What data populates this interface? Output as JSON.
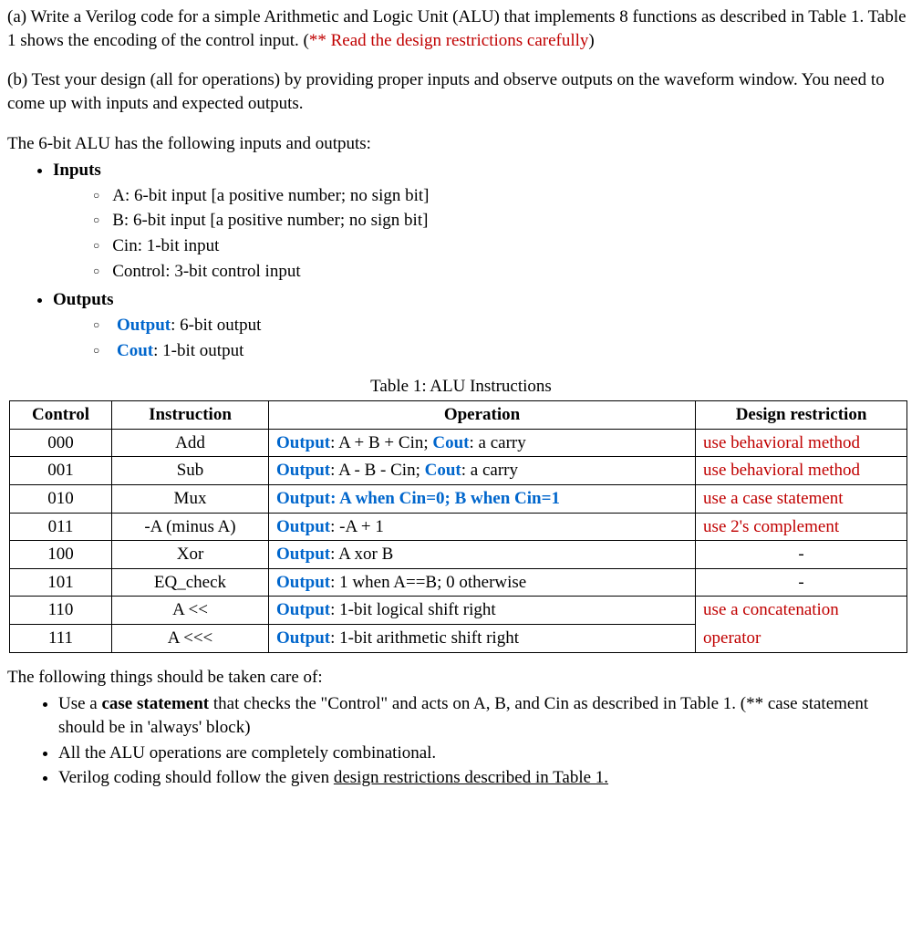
{
  "partA": {
    "prefix": "(a) Write a Verilog code for a simple Arithmetic and Logic Unit (ALU) that implements 8 functions as described in Table 1.  Table 1 shows the encoding of the control input. (",
    "warn": "** Read the design restrictions carefully",
    "suffix": ")"
  },
  "partB": "(b) Test your design (all for operations) by providing proper inputs and observe outputs on the waveform window. You need to come up with inputs and expected outputs.",
  "ioIntro": "The 6-bit ALU has the following inputs and outputs:",
  "inputsLabel": "Inputs",
  "inputs": {
    "a": "A: 6-bit input [a positive number; no sign bit]",
    "b": "B: 6-bit input [a positive number; no sign bit]",
    "cin": "Cin: 1-bit input",
    "control": "Control: 3-bit control input"
  },
  "outputsLabel": "Outputs",
  "outputs": {
    "out_label": "Output",
    "out_rest": ": 6-bit output",
    "cout_label": "Cout",
    "cout_rest": ": 1-bit output"
  },
  "tableTitle": "Table 1: ALU Instructions",
  "headers": {
    "control": "Control",
    "instruction": "Instruction",
    "operation": "Operation",
    "restriction": "Design restriction"
  },
  "rows": [
    {
      "control": "000",
      "instruction": "Add",
      "op_prefix": "Output",
      "op_mid": ": A + B + Cin; ",
      "op_cout": "Cout",
      "op_suffix": ": a carry",
      "restriction": "use behavioral method",
      "restriction_red": true
    },
    {
      "control": "001",
      "instruction": "Sub",
      "op_prefix": "Output",
      "op_mid": ": A - B - Cin;  ",
      "op_cout": "Cout",
      "op_suffix": ": a carry",
      "restriction": "use behavioral method",
      "restriction_red": true
    },
    {
      "control": "010",
      "instruction": "Mux",
      "op_prefix": "Output",
      "op_mid": ": A when Cin=0; B when Cin=1",
      "op_allblue": true,
      "restriction": "use a case statement",
      "restriction_red": true
    },
    {
      "control": "011",
      "instruction": "-A (minus A)",
      "op_prefix": "Output",
      "op_mid": ": -A + 1",
      "restriction": "use 2's complement",
      "restriction_red": true
    },
    {
      "control": "100",
      "instruction": "Xor",
      "op_prefix": "Output",
      "op_mid": ": A xor B",
      "restriction": "-",
      "restriction_center": true
    },
    {
      "control": "101",
      "instruction": "EQ_check",
      "op_prefix": "Output",
      "op_mid": ": 1 when A==B; 0 otherwise",
      "restriction": "-",
      "restriction_center": true
    },
    {
      "control": "110",
      "instruction": "A <<",
      "op_prefix": "Output",
      "op_mid": ": 1-bit logical shift right",
      "restriction": "use a concatenation",
      "restriction_red": true,
      "merge_down": true
    },
    {
      "control": "111",
      "instruction": "A <<<",
      "op_prefix": "Output",
      "op_mid": ": 1-bit arithmetic shift right",
      "restriction": "operator",
      "restriction_red": true,
      "merge_up": true
    }
  ],
  "notesIntro": "The following things should be taken care of:",
  "notes": {
    "n1a": "Use a ",
    "n1b": "case statement",
    "n1c": " that checks the \"Control\" and acts on A, B, and Cin as described in Table 1. (** case statement should be in 'always' block)",
    "n2": "All the ALU operations are completely combinational.",
    "n3a": "Verilog coding should follow the given ",
    "n3b": "design restrictions described in Table 1."
  }
}
